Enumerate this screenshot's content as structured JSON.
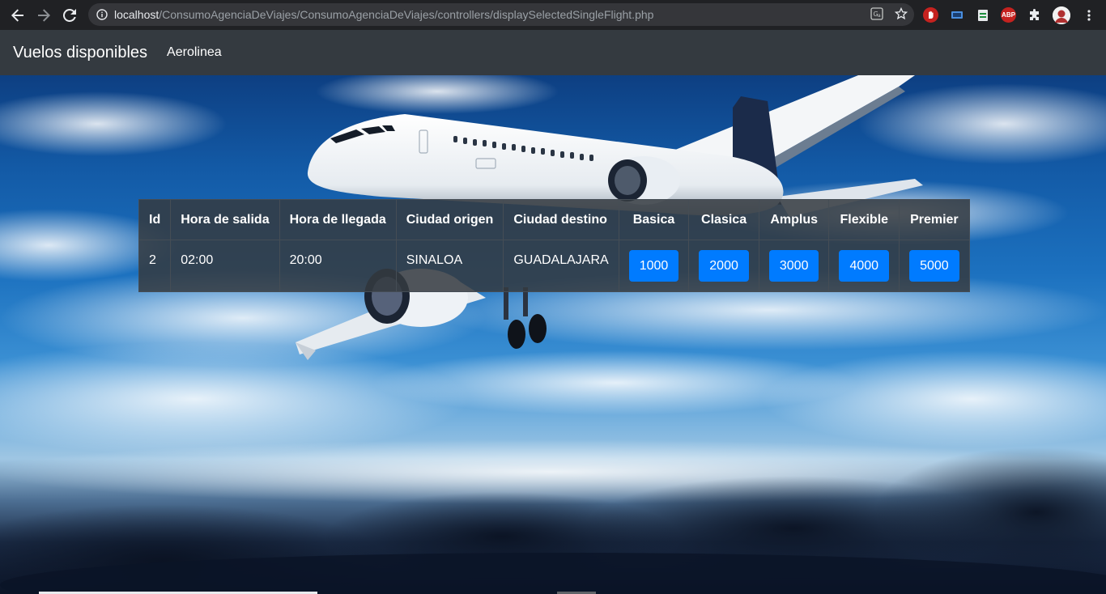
{
  "browser": {
    "url_host": "localhost",
    "url_path": "/ConsumoAgenciaDeViajes/ConsumoAgenciaDeViajes/controllers/displaySelectedSingleFlight.php",
    "icons": [
      "back-arrow-icon",
      "forward-arrow-icon",
      "reload-icon",
      "info-icon",
      "translate-icon",
      "star-icon",
      "hand-stop-icon",
      "screen-icon",
      "sheet-icon",
      "abp-icon",
      "puzzle-icon",
      "profile-avatar",
      "kebab-menu-icon"
    ],
    "abp_label": "ABP"
  },
  "navbar": {
    "brand": "Vuelos disponibles",
    "link": "Aerolinea"
  },
  "table": {
    "headers": {
      "id": "Id",
      "departure": "Hora de salida",
      "arrival": "Hora de llegada",
      "origin": "Ciudad origen",
      "destination": "Ciudad destino",
      "basica": "Basica",
      "clasica": "Clasica",
      "amplus": "Amplus",
      "flexible": "Flexible",
      "premier": "Premier"
    },
    "row": {
      "id": "2",
      "departure": "02:00",
      "arrival": "20:00",
      "origin": "SINALOA",
      "destination": "GUADALAJARA",
      "basica": "1000",
      "clasica": "2000",
      "amplus": "3000",
      "flexible": "4000",
      "premier": "5000"
    }
  },
  "colors": {
    "navbar_bg": "#343a40",
    "button_primary": "#007bff",
    "chrome_bg": "#202124"
  }
}
